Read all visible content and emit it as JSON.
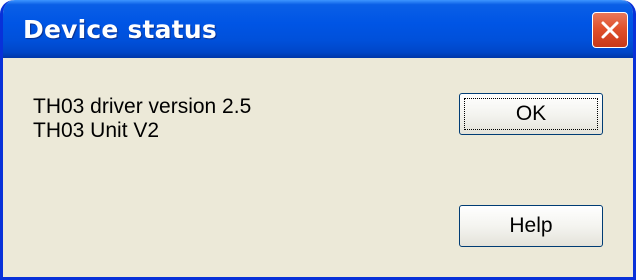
{
  "window": {
    "title": "Device status",
    "close_icon": "close-icon",
    "accent_color": "#0055e5",
    "close_color": "#e0512c"
  },
  "content": {
    "driver_line": "TH03 driver version 2.5",
    "unit_line": "TH03 Unit V2"
  },
  "buttons": {
    "ok_label": "OK",
    "help_label": "Help"
  }
}
